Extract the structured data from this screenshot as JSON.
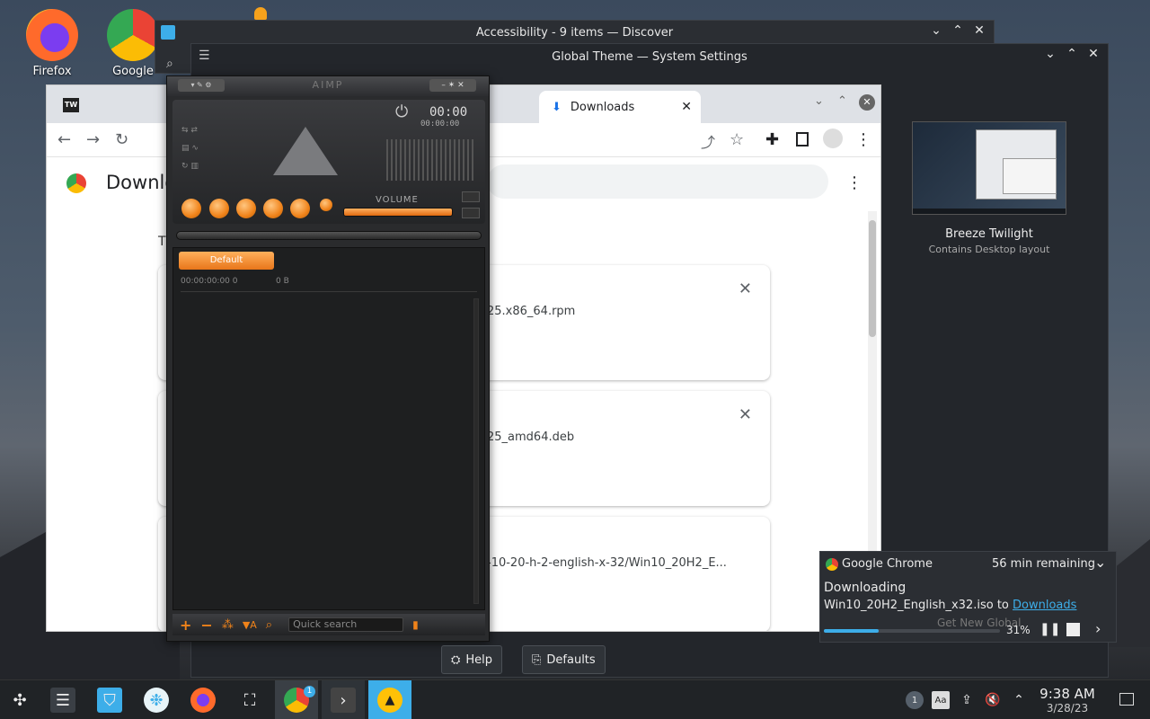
{
  "desktop": {
    "icons": [
      {
        "label": "Firefox"
      },
      {
        "label": "Google"
      }
    ]
  },
  "discover": {
    "title": "Accessibility - 9 items — Discover"
  },
  "settings": {
    "title": "Global Theme — System Settings",
    "theme_name": "Breeze Twilight",
    "theme_desc": "Contains Desktop layout",
    "help": "Help",
    "defaults": "Defaults"
  },
  "chrome": {
    "tab_title": "Downloads",
    "page_title": "Downlo",
    "section_letter": "T",
    "downloads": [
      {
        "filename": "25.x86_64.rpm"
      },
      {
        "filename": "25_amd64.deb"
      },
      {
        "filename": "-10-20-h-2-english-x-32/Win10_20H2_E..."
      }
    ]
  },
  "aimp": {
    "title": "AIMP",
    "time": "00:00",
    "time_small": "00:00:00",
    "volume_label": "VOLUME",
    "playlist_tab": "Default",
    "playlist_info": "00:00:00:00   0",
    "size": "0 B",
    "quick_search": "Quick search"
  },
  "notification": {
    "app": "Google Chrome",
    "remaining": "56 min remaining",
    "heading": "Downloading",
    "file_text": "Win10_20H2_English_x32.iso to ",
    "link": "Downloads",
    "percent": "31%",
    "progress": 0.31,
    "ghost": "Get New Global"
  },
  "taskbar": {
    "clock_time": "9:38 AM",
    "clock_date": "3/28/23",
    "chrome_badge": "1",
    "tray_badge": "1"
  }
}
